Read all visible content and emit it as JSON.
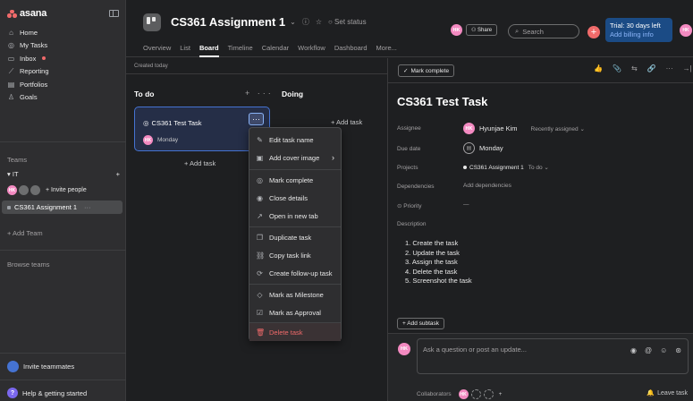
{
  "sidebar": {
    "brand": "asana",
    "nav": [
      {
        "icon": "home-icon",
        "glyph": "⌂",
        "label": "Home"
      },
      {
        "icon": "check-circle-icon",
        "glyph": "◎",
        "label": "My Tasks"
      },
      {
        "icon": "inbox-icon",
        "glyph": "▭",
        "label": "Inbox"
      },
      {
        "icon": "reporting-icon",
        "glyph": "⟋",
        "label": "Reporting"
      },
      {
        "icon": "portfolios-icon",
        "glyph": "▤",
        "label": "Portfolios"
      },
      {
        "icon": "goals-icon",
        "glyph": "♙",
        "label": "Goals"
      }
    ],
    "teams_heading": "Teams",
    "team": {
      "name": "IT",
      "add": "+"
    },
    "members": {
      "initials": "HK",
      "invite": "+ Invite people"
    },
    "project": {
      "name": "CS361 Assignment 1",
      "more": "···"
    },
    "add_team": "+ Add Team",
    "browse_teams": "Browse teams",
    "invite_teammates": "Invite teammates",
    "help": {
      "badge": "?",
      "label": "Help & getting started"
    }
  },
  "header": {
    "title": "CS361 Assignment 1",
    "title_icons": [
      "⌄",
      "ⓘ",
      "☆"
    ],
    "set_status": "○ Set status",
    "tabs": [
      "Overview",
      "List",
      "Board",
      "Timeline",
      "Calendar",
      "Workflow",
      "Dashboard",
      "More..."
    ],
    "active_tab": "Board",
    "avatar": "HK",
    "share": "Share",
    "search_placeholder": "Search",
    "plus": "+",
    "trial": {
      "line1": "Trial: 30 days left",
      "line2": "Add billing info"
    }
  },
  "board": {
    "date_label": "Created today",
    "columns": [
      {
        "title": "To do",
        "add": "+",
        "more": "···"
      },
      {
        "title": "Doing"
      }
    ],
    "card": {
      "name": "CS361 Test Task",
      "assignee": "HK",
      "due": "Monday",
      "more": "···"
    },
    "add_task": "+ Add task"
  },
  "context_menu": {
    "items": [
      {
        "icon": "pencil-icon",
        "glyph": "✎",
        "label": "Edit task name"
      },
      {
        "icon": "image-icon",
        "glyph": "▣",
        "label": "Add cover image",
        "arrow": "›"
      },
      {
        "icon": "check-circle-icon",
        "glyph": "◎",
        "label": "Mark complete"
      },
      {
        "icon": "eye-icon",
        "glyph": "◉",
        "label": "Close details"
      },
      {
        "icon": "external-link-icon",
        "glyph": "↗",
        "label": "Open in new tab"
      },
      {
        "icon": "duplicate-icon",
        "glyph": "❐",
        "label": "Duplicate task"
      },
      {
        "icon": "link-icon",
        "glyph": "⛓",
        "label": "Copy task link"
      },
      {
        "icon": "follow-up-icon",
        "glyph": "⟳",
        "label": "Create follow-up task"
      },
      {
        "icon": "milestone-icon",
        "glyph": "◇",
        "label": "Mark as Milestone"
      },
      {
        "icon": "approval-icon",
        "glyph": "☑",
        "label": "Mark as Approval"
      },
      {
        "icon": "trash-icon",
        "glyph": "🗑",
        "label": "Delete task"
      }
    ]
  },
  "detail": {
    "mark_complete": "Mark complete",
    "toolbar_icons": [
      "👍",
      "📎",
      "⇆",
      "🔗",
      "···",
      "→|"
    ],
    "title": "CS361 Test Task",
    "fields": {
      "assignee_label": "Assignee",
      "assignee_initials": "HK",
      "assignee_name": "Hyunjae Kim",
      "assignee_note": "Recently assigned ⌄",
      "due_label": "Due date",
      "due_value": "Monday",
      "projects_label": "Projects",
      "project_name": "CS361 Assignment 1",
      "project_section": "To do ⌄",
      "dependencies_label": "Dependencies",
      "dependencies_value": "Add dependencies",
      "priority_label": "Priority",
      "priority_value": "—",
      "description_label": "Description"
    },
    "description": [
      "1. Create the task",
      "2. Update the task",
      "3. Assign the task",
      "4. Delete the task",
      "5. Screenshot the task"
    ],
    "add_subtask": "+ Add subtask",
    "comment": {
      "avatar": "HK",
      "placeholder": "Ask a question or post an update...",
      "tools": [
        "◉",
        "@",
        "☺",
        "⊛"
      ],
      "collaborators_label": "Collaborators",
      "collab_plus": "+",
      "leave": "Leave task"
    }
  },
  "colors": {
    "brand_coral": "#f06a6a",
    "avatar_pink": "#f38ac1",
    "selected_blue": "#4573d2",
    "trial_bg": "#1b4b85"
  }
}
